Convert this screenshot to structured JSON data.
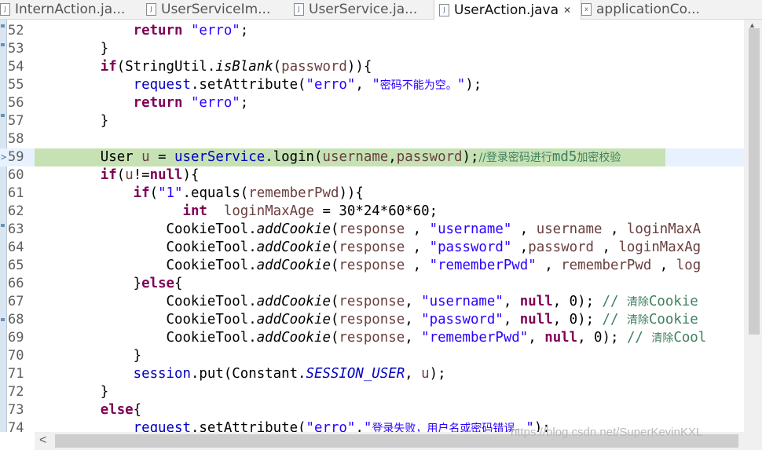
{
  "tabs": [
    {
      "label": "InternAction.ja...",
      "active": false
    },
    {
      "label": "UserServiceIm...",
      "active": false
    },
    {
      "label": "UserService.ja...",
      "active": false
    },
    {
      "label": "UserAction.java",
      "active": true,
      "close": "✕"
    },
    {
      "label": "applicationCo...",
      "active": false
    }
  ],
  "editor": {
    "current_line": "59",
    "watermark": "https://blog.csdn.net/SuperKevinKXL",
    "lines": [
      {
        "n": "52",
        "t": [
          [
            "            ",
            ""
          ],
          [
            "return",
            "kw"
          ],
          [
            " ",
            ""
          ],
          [
            "\"erro\"",
            "str"
          ],
          [
            ";",
            ""
          ]
        ]
      },
      {
        "n": "53",
        "t": [
          [
            "        }",
            ""
          ]
        ]
      },
      {
        "n": "54",
        "t": [
          [
            "        ",
            ""
          ],
          [
            "if",
            "kw"
          ],
          [
            "(StringUtil.",
            ""
          ],
          [
            "isBlank",
            "ital"
          ],
          [
            "(",
            ""
          ],
          [
            "password",
            "var"
          ],
          [
            ")){",
            ""
          ]
        ]
      },
      {
        "n": "55",
        "t": [
          [
            "            ",
            ""
          ],
          [
            "request",
            "fld"
          ],
          [
            ".setAttribute(",
            ""
          ],
          [
            "\"erro\"",
            "str"
          ],
          [
            ", ",
            ""
          ],
          [
            "\"",
            "str"
          ],
          [
            "密码不能为空。",
            "str cjk"
          ],
          [
            "\"",
            "str"
          ],
          [
            ");",
            ""
          ]
        ]
      },
      {
        "n": "56",
        "t": [
          [
            "            ",
            ""
          ],
          [
            "return",
            "kw"
          ],
          [
            " ",
            ""
          ],
          [
            "\"erro\"",
            "str"
          ],
          [
            ";",
            ""
          ]
        ]
      },
      {
        "n": "57",
        "t": [
          [
            "        }",
            ""
          ]
        ]
      },
      {
        "n": "58",
        "t": [
          [
            "",
            ""
          ]
        ]
      },
      {
        "n": "59",
        "t": [
          [
            "        User ",
            ""
          ],
          [
            "u",
            "var"
          ],
          [
            " = ",
            ""
          ],
          [
            "userService",
            "fld"
          ],
          [
            ".login(",
            ""
          ],
          [
            "username",
            "var"
          ],
          [
            ",",
            ""
          ],
          [
            "password",
            "var"
          ],
          [
            ");",
            ""
          ],
          [
            "//登录密码进行",
            "cmt cjk"
          ],
          [
            "md5",
            "cmt"
          ],
          [
            "加密校验",
            "cmt cjk"
          ]
        ]
      },
      {
        "n": "60",
        "t": [
          [
            "        ",
            ""
          ],
          [
            "if",
            "kw"
          ],
          [
            "(",
            ""
          ],
          [
            "u",
            "var"
          ],
          [
            "!=",
            ""
          ],
          [
            "null",
            "kw"
          ],
          [
            "){",
            ""
          ]
        ]
      },
      {
        "n": "61",
        "t": [
          [
            "            ",
            ""
          ],
          [
            "if",
            "kw"
          ],
          [
            "(",
            ""
          ],
          [
            "\"1\"",
            "str"
          ],
          [
            ".equals(",
            ""
          ],
          [
            "rememberPwd",
            "var"
          ],
          [
            ")){",
            ""
          ]
        ]
      },
      {
        "n": "62",
        "t": [
          [
            "                  ",
            ""
          ],
          [
            "int",
            "kw"
          ],
          [
            "  ",
            ""
          ],
          [
            "loginMaxAge",
            "var"
          ],
          [
            " = 30*24*60*60;",
            ""
          ]
        ]
      },
      {
        "n": "63",
        "t": [
          [
            "                CookieTool.",
            ""
          ],
          [
            "addCookie",
            "ital"
          ],
          [
            "(",
            ""
          ],
          [
            "response",
            "var"
          ],
          [
            " , ",
            ""
          ],
          [
            "\"username\"",
            "str"
          ],
          [
            " , ",
            ""
          ],
          [
            "username",
            "var"
          ],
          [
            " , ",
            ""
          ],
          [
            "loginMaxA",
            "var"
          ]
        ]
      },
      {
        "n": "64",
        "t": [
          [
            "                CookieTool.",
            ""
          ],
          [
            "addCookie",
            "ital"
          ],
          [
            "(",
            ""
          ],
          [
            "response",
            "var"
          ],
          [
            " , ",
            ""
          ],
          [
            "\"password\"",
            "str"
          ],
          [
            " ,",
            ""
          ],
          [
            "password",
            "var"
          ],
          [
            " , ",
            ""
          ],
          [
            "loginMaxAg",
            "var"
          ]
        ]
      },
      {
        "n": "65",
        "t": [
          [
            "                CookieTool.",
            ""
          ],
          [
            "addCookie",
            "ital"
          ],
          [
            "(",
            ""
          ],
          [
            "response",
            "var"
          ],
          [
            " , ",
            ""
          ],
          [
            "\"rememberPwd\"",
            "str"
          ],
          [
            " , ",
            ""
          ],
          [
            "rememberPwd",
            "var"
          ],
          [
            " , ",
            ""
          ],
          [
            "log",
            "var"
          ]
        ]
      },
      {
        "n": "66",
        "t": [
          [
            "            }",
            ""
          ],
          [
            "else",
            "kw"
          ],
          [
            "{",
            ""
          ]
        ]
      },
      {
        "n": "67",
        "t": [
          [
            "                CookieTool.",
            ""
          ],
          [
            "addCookie",
            "ital"
          ],
          [
            "(",
            ""
          ],
          [
            "response",
            "var"
          ],
          [
            ", ",
            ""
          ],
          [
            "\"username\"",
            "str"
          ],
          [
            ", ",
            ""
          ],
          [
            "null",
            "kw"
          ],
          [
            ", 0); ",
            ""
          ],
          [
            "// ",
            "cmt"
          ],
          [
            "清除",
            "cmt cjk"
          ],
          [
            "Cookie",
            "cmt"
          ]
        ]
      },
      {
        "n": "68",
        "t": [
          [
            "                CookieTool.",
            ""
          ],
          [
            "addCookie",
            "ital"
          ],
          [
            "(",
            ""
          ],
          [
            "response",
            "var"
          ],
          [
            ", ",
            ""
          ],
          [
            "\"password\"",
            "str"
          ],
          [
            ", ",
            ""
          ],
          [
            "null",
            "kw"
          ],
          [
            ", 0); ",
            ""
          ],
          [
            "// ",
            "cmt"
          ],
          [
            "清除",
            "cmt cjk"
          ],
          [
            "Cookie",
            "cmt"
          ]
        ]
      },
      {
        "n": "69",
        "t": [
          [
            "                CookieTool.",
            ""
          ],
          [
            "addCookie",
            "ital"
          ],
          [
            "(",
            ""
          ],
          [
            "response",
            "var"
          ],
          [
            ", ",
            ""
          ],
          [
            "\"rememberPwd\"",
            "str"
          ],
          [
            ", ",
            ""
          ],
          [
            "null",
            "kw"
          ],
          [
            ", 0); ",
            ""
          ],
          [
            "// ",
            "cmt"
          ],
          [
            "清除",
            "cmt cjk"
          ],
          [
            "Cool",
            "cmt"
          ]
        ]
      },
      {
        "n": "70",
        "t": [
          [
            "            }",
            ""
          ]
        ]
      },
      {
        "n": "71",
        "t": [
          [
            "            ",
            ""
          ],
          [
            "session",
            "fld"
          ],
          [
            ".put(Constant.",
            ""
          ],
          [
            "SESSION_USER",
            "fld ital"
          ],
          [
            ", ",
            ""
          ],
          [
            "u",
            "var"
          ],
          [
            ");",
            ""
          ]
        ]
      },
      {
        "n": "72",
        "t": [
          [
            "        }",
            ""
          ]
        ]
      },
      {
        "n": "73",
        "t": [
          [
            "        ",
            ""
          ],
          [
            "else",
            "kw"
          ],
          [
            "{",
            ""
          ]
        ]
      },
      {
        "n": "74",
        "t": [
          [
            "            ",
            ""
          ],
          [
            "request",
            "fld"
          ],
          [
            ".setAttribute(",
            ""
          ],
          [
            "\"erro\"",
            "str"
          ],
          [
            ",",
            ""
          ],
          [
            "\"",
            "str"
          ],
          [
            "登录失败，用户名或密码错误。",
            "str cjk"
          ],
          [
            "\"",
            "str"
          ],
          [
            ");",
            ""
          ]
        ]
      }
    ]
  },
  "scroll": {
    "left_arrow": "<",
    "up_arrow": "▲"
  }
}
